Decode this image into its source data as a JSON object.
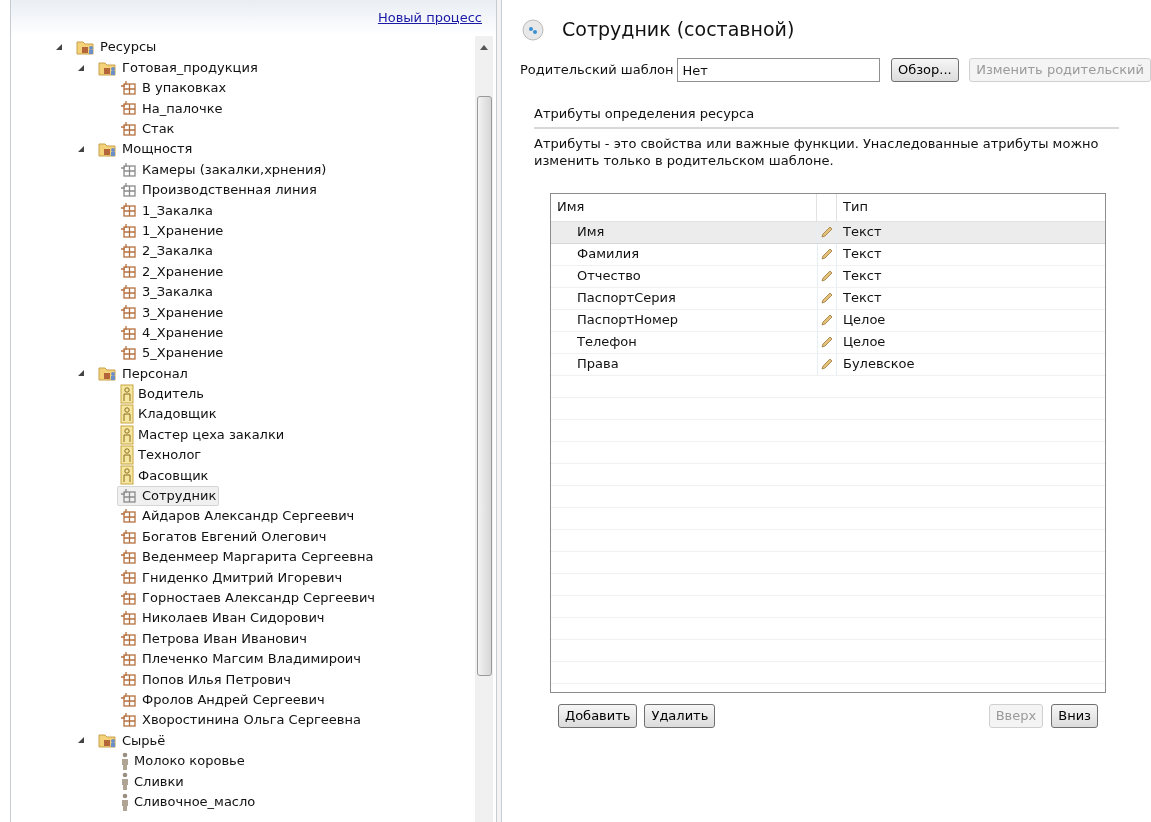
{
  "new_process_link": "Новый процесс",
  "tree": [
    {
      "label": "Ресурсы",
      "kind": "folder",
      "expanded": true,
      "selected": false,
      "children": [
        {
          "label": "Готовая_продукция",
          "kind": "folder",
          "expanded": true,
          "selected": false,
          "children": [
            {
              "label": "В упаковках",
              "kind": "product",
              "selected": false
            },
            {
              "label": "На_палочке",
              "kind": "product",
              "selected": false
            },
            {
              "label": "Стак",
              "kind": "product",
              "selected": false
            }
          ]
        },
        {
          "label": "Мощностя",
          "kind": "folder",
          "expanded": true,
          "selected": false,
          "children": [
            {
              "label": "Камеры (закалки,хрнения)",
              "kind": "template",
              "selected": false
            },
            {
              "label": "Производственная линия",
              "kind": "template",
              "selected": false
            },
            {
              "label": "1_Закалка",
              "kind": "product",
              "selected": false
            },
            {
              "label": "1_Хранение",
              "kind": "product",
              "selected": false
            },
            {
              "label": "2_Закалка",
              "kind": "product",
              "selected": false
            },
            {
              "label": "2_Хранение",
              "kind": "product",
              "selected": false
            },
            {
              "label": "3_Закалка",
              "kind": "product",
              "selected": false
            },
            {
              "label": "3_Хранение",
              "kind": "product",
              "selected": false
            },
            {
              "label": "4_Хранение",
              "kind": "product",
              "selected": false
            },
            {
              "label": "5_Хранение",
              "kind": "product",
              "selected": false
            }
          ]
        },
        {
          "label": "Персонал",
          "kind": "folder",
          "expanded": true,
          "selected": false,
          "children": [
            {
              "label": "Водитель",
              "kind": "role",
              "selected": false
            },
            {
              "label": "Кладовщик",
              "kind": "role",
              "selected": false
            },
            {
              "label": "Мастер цеха закалки",
              "kind": "role",
              "selected": false
            },
            {
              "label": "Технолог",
              "kind": "role",
              "selected": false
            },
            {
              "label": "Фасовщик",
              "kind": "role",
              "selected": false
            },
            {
              "label": "Сотрудник",
              "kind": "template",
              "selected": true
            },
            {
              "label": "Айдаров Александр Сергеевич",
              "kind": "product",
              "selected": false
            },
            {
              "label": "Богатов Евгений Олегович",
              "kind": "product",
              "selected": false
            },
            {
              "label": "Веденмеер Маргарита Сергеевна",
              "kind": "product",
              "selected": false
            },
            {
              "label": "Гниденко Дмитрий Игоревич",
              "kind": "product",
              "selected": false
            },
            {
              "label": "Горностаев Александр Сергеевич",
              "kind": "product",
              "selected": false
            },
            {
              "label": "Николаев Иван Сидорович",
              "kind": "product",
              "selected": false
            },
            {
              "label": "Петрова Иван Иванович",
              "kind": "product",
              "selected": false
            },
            {
              "label": "Плеченко Магсим Владимироич",
              "kind": "product",
              "selected": false
            },
            {
              "label": "Попов Илья Петрович",
              "kind": "product",
              "selected": false
            },
            {
              "label": "Фролов Андрей Сергеевич",
              "kind": "product",
              "selected": false
            },
            {
              "label": "Хворостинина Ольга Сергеевна",
              "kind": "product",
              "selected": false
            }
          ]
        },
        {
          "label": "Сырьё",
          "kind": "folder",
          "expanded": true,
          "selected": false,
          "children": [
            {
              "label": "Молоко коровье",
              "kind": "material",
              "selected": false
            },
            {
              "label": "Сливки",
              "kind": "material",
              "selected": false
            },
            {
              "label": "Сливочное_масло",
              "kind": "material",
              "selected": false
            }
          ]
        }
      ]
    }
  ],
  "editor": {
    "title": "Сотрудник (составной)",
    "parent_template": {
      "label": "Родительский шаблон",
      "value": "Нет"
    },
    "browse_button": {
      "label": "Обзор...",
      "disabled": false
    },
    "change_parent_button": {
      "label": "Изменить родительский",
      "disabled": true
    },
    "section": {
      "title": "Атрибуты определения ресурса",
      "description": "Атрибуты - это свойства или важные функции. Унаследованные атрибуты можно изменить только в родительском шаблоне."
    },
    "table": {
      "columns": [
        "Имя",
        "Тип"
      ],
      "rows": [
        {
          "name": "Имя",
          "type": "Текст",
          "selected": true
        },
        {
          "name": "Фамилия",
          "type": "Текст",
          "selected": false
        },
        {
          "name": "Отчество",
          "type": "Текст",
          "selected": false
        },
        {
          "name": "ПаспортСерия",
          "type": "Текст",
          "selected": false
        },
        {
          "name": "ПаспортНомер",
          "type": "Целое",
          "selected": false
        },
        {
          "name": "Телефон",
          "type": "Целое",
          "selected": false
        },
        {
          "name": "Права",
          "type": "Булевское",
          "selected": false
        }
      ]
    },
    "buttons_left": [
      {
        "label": "Добавить",
        "disabled": false
      },
      {
        "label": "Удалить",
        "disabled": false
      }
    ],
    "buttons_right": [
      {
        "label": "Вверх",
        "disabled": true
      },
      {
        "label": "Вниз",
        "disabled": false
      }
    ]
  }
}
